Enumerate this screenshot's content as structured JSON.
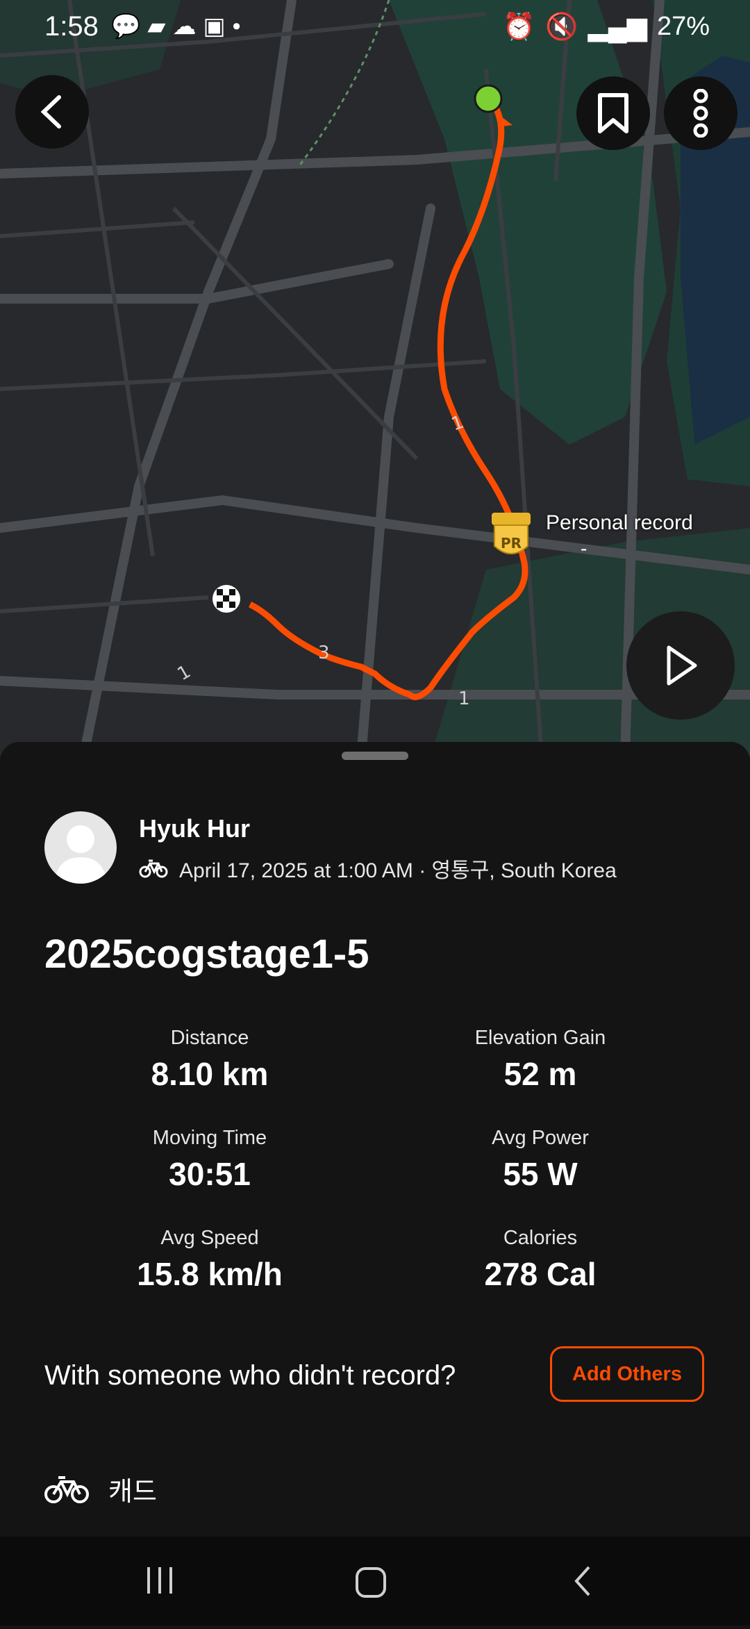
{
  "status_bar": {
    "time": "1:58",
    "left_icons": [
      "talk-icon",
      "feather-icon",
      "chat-icon",
      "cloud-icon",
      "image-icon",
      "dot-icon"
    ],
    "right_icons": [
      "battery-saver-icon",
      "alarm-icon",
      "mute-icon",
      "lte-icon",
      "signal-icon"
    ],
    "battery": "27%"
  },
  "map": {
    "route_color": "#fc4c02",
    "start_color": "#7cd034",
    "pr_label": "Personal record",
    "pr_sub": "-",
    "pr_badge": "PR",
    "km_markers": [
      "1",
      "3",
      "1",
      "1"
    ]
  },
  "activity": {
    "athlete": "Hyuk Hur",
    "meta": "April 17, 2025 at 1:00 AM · 영통구, South Korea",
    "title": "2025cogstage1-5",
    "stats": [
      {
        "label": "Distance",
        "value": "8.10 km"
      },
      {
        "label": "Elevation Gain",
        "value": "52 m"
      },
      {
        "label": "Moving Time",
        "value": "30:51"
      },
      {
        "label": "Avg Power",
        "value": "55 W"
      },
      {
        "label": "Avg Speed",
        "value": "15.8 km/h"
      },
      {
        "label": "Calories",
        "value": "278 Cal"
      }
    ],
    "with_prompt": "With someone who didn't record?",
    "add_others": "Add Others",
    "gear": "캐드"
  }
}
